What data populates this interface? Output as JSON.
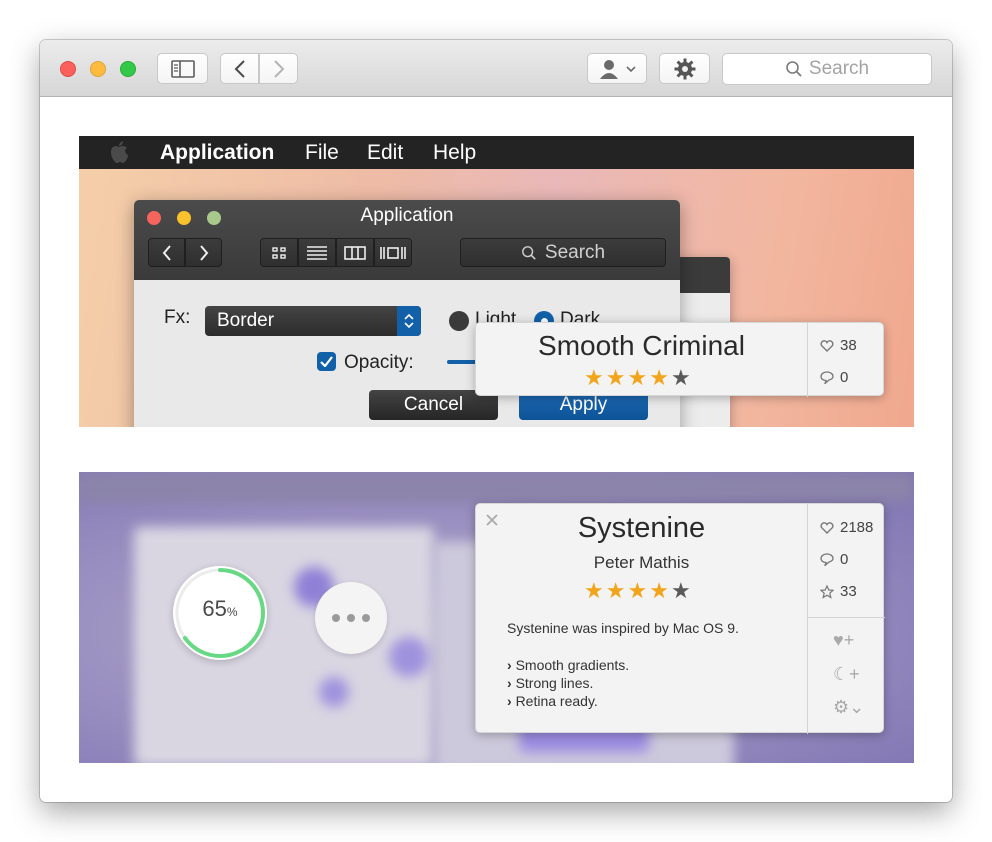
{
  "toolbar": {
    "sidebar_icon": "sidebar-icon",
    "back_icon": "chevron-left-icon",
    "forward_icon": "chevron-right-icon",
    "user_icon": "user-icon",
    "settings_icon": "gear-icon",
    "search_placeholder": "Search"
  },
  "menubar": {
    "apple_icon": "apple-icon",
    "items": [
      "Application",
      "File",
      "Edit",
      "Help"
    ]
  },
  "app_window": {
    "title": "Application",
    "search_placeholder": "Search",
    "fx_label": "Fx:",
    "fx_value": "Border",
    "theme_light": "Light",
    "theme_dark": "Dark",
    "theme_selected": "Dark",
    "opacity_label": "Opacity:",
    "opacity_checked": true,
    "cancel_label": "Cancel",
    "apply_label": "Apply"
  },
  "popover_small": {
    "title": "Smooth Criminal",
    "rating": 4,
    "rating_max": 5,
    "likes": "38",
    "comments": "0"
  },
  "progress": {
    "value": "65",
    "unit": "%",
    "fraction": 0.65
  },
  "popover_large": {
    "title": "Systenine",
    "author": "Peter Mathis",
    "rating": 4,
    "rating_max": 5,
    "likes": "2188",
    "comments": "0",
    "favorites": "33",
    "description": "Systenine was inspired by Mac OS 9.",
    "features": [
      "Smooth gradients.",
      "Strong lines.",
      "Retina ready."
    ]
  },
  "colors": {
    "accent_blue": "#0d5fa6",
    "star_gold": "#f2a51b",
    "progress_green": "#67d884",
    "traffic_red": "#fc605c",
    "traffic_yellow": "#fdbc40",
    "traffic_green": "#34c84a"
  }
}
